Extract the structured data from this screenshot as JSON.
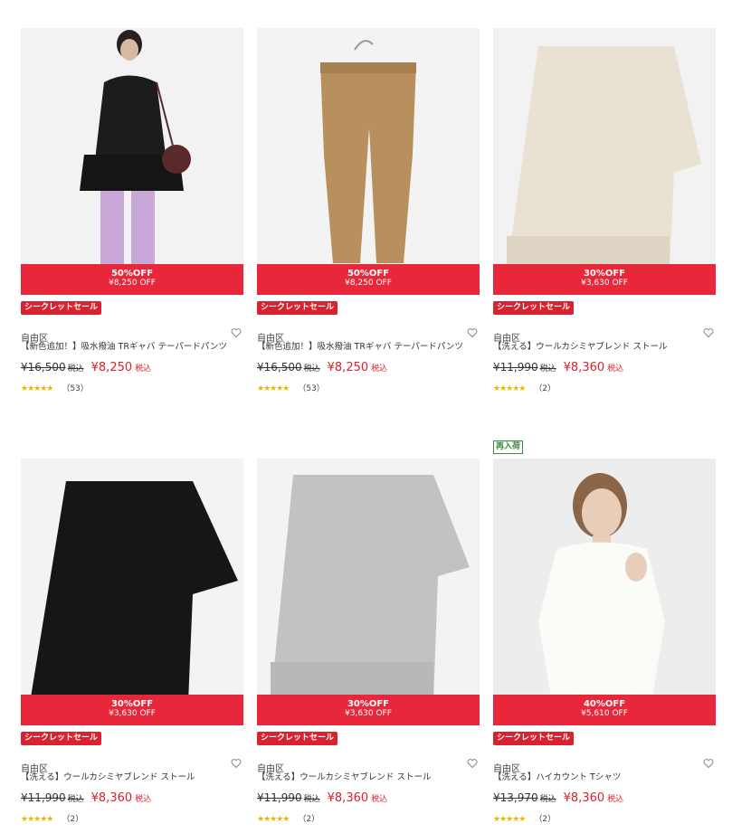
{
  "products": [
    {
      "discount_pct": "50%OFF",
      "discount_amt": "¥8,250 OFF",
      "badge": "シークレットセール",
      "brand": "自由区",
      "name": "【新色追加！】吸水撥油 TRギャバ テーパードパンツ",
      "orig_price": "¥16,500",
      "tax_label": "税込",
      "sale_price": "¥8,250",
      "sale_tax": "税込",
      "stars": "★★★★★",
      "rating": 4.5,
      "count": "（53）",
      "image": "model-black-dress-lilac-pants"
    },
    {
      "discount_pct": "50%OFF",
      "discount_amt": "¥8,250 OFF",
      "badge": "シークレットセール",
      "brand": "自由区",
      "name": "【新色追加！】吸水撥油 TRギャバ テーパードパンツ",
      "orig_price": "¥16,500",
      "tax_label": "税込",
      "sale_price": "¥8,250",
      "sale_tax": "税込",
      "stars": "★★★★★",
      "rating": 4.5,
      "count": "（53）",
      "image": "camel-tapered-pants-on-hanger"
    },
    {
      "discount_pct": "30%OFF",
      "discount_amt": "¥3,630 OFF",
      "badge": "シークレットセール",
      "brand": "自由区",
      "name": "【洗える】ウールカシミヤブレンド ストール",
      "orig_price": "¥11,990",
      "tax_label": "税込",
      "sale_price": "¥8,360",
      "sale_tax": "税込",
      "stars": "★★★★★",
      "rating": 5,
      "count": "（2）",
      "image": "ivory-stole"
    },
    {
      "discount_pct": "30%OFF",
      "discount_amt": "¥3,630 OFF",
      "badge": "シークレットセール",
      "brand": "自由区",
      "name": "【洗える】ウールカシミヤブレンド ストール",
      "orig_price": "¥11,990",
      "tax_label": "税込",
      "sale_price": "¥8,360",
      "sale_tax": "税込",
      "stars": "★★★★★",
      "rating": 5,
      "count": "（2）",
      "image": "black-stole"
    },
    {
      "discount_pct": "30%OFF",
      "discount_amt": "¥3,630 OFF",
      "badge": "シークレットセール",
      "brand": "自由区",
      "name": "【洗える】ウールカシミヤブレンド ストール",
      "orig_price": "¥11,990",
      "tax_label": "税込",
      "sale_price": "¥8,360",
      "sale_tax": "税込",
      "stars": "★★★★★",
      "rating": 5,
      "count": "（2）",
      "image": "grey-stole"
    },
    {
      "discount_pct": "40%OFF",
      "discount_amt": "¥5,610 OFF",
      "badge": "シークレットセール",
      "brand": "自由区",
      "name": "【洗える】ハイカウント Tシャツ",
      "orig_price": "¥13,970",
      "tax_label": "税込",
      "sale_price": "¥8,360",
      "sale_tax": "税込",
      "stars": "★★★★★",
      "rating": 5,
      "count": "（2）",
      "image": "model-white-tshirt"
    }
  ],
  "restock_badge": "再入荷",
  "colors": {
    "sale_red": "#e8283a",
    "star_gold": "#e6b800",
    "restock_green": "#3a8a3a"
  }
}
